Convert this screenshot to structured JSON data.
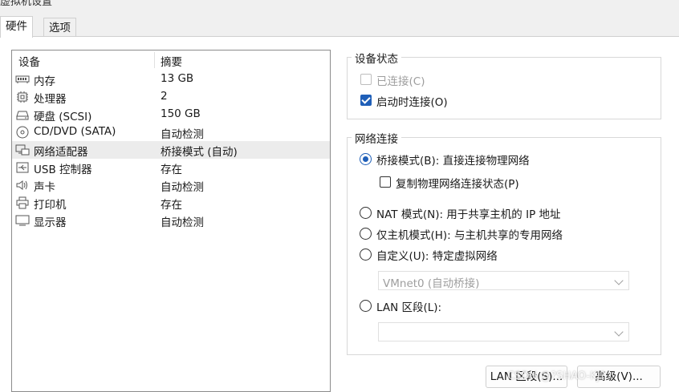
{
  "window": {
    "title_fragment": "虚拟机设置"
  },
  "tabs": [
    {
      "label": "硬件",
      "active": true
    },
    {
      "label": "选项",
      "active": false
    }
  ],
  "device_list": {
    "headers": {
      "device": "设备",
      "summary": "摘要"
    },
    "rows": [
      {
        "icon": "memory-icon",
        "name": "内存",
        "summary": "13 GB",
        "selected": false
      },
      {
        "icon": "processor-icon",
        "name": "处理器",
        "summary": "2",
        "selected": false
      },
      {
        "icon": "hard-disk-icon",
        "name": "硬盘 (SCSI)",
        "summary": "150 GB",
        "selected": false
      },
      {
        "icon": "cd-dvd-icon",
        "name": "CD/DVD (SATA)",
        "summary": "自动检测",
        "selected": false
      },
      {
        "icon": "network-adapter-icon",
        "name": "网络适配器",
        "summary": "桥接模式 (自动)",
        "selected": true
      },
      {
        "icon": "usb-icon",
        "name": "USB 控制器",
        "summary": "存在",
        "selected": false
      },
      {
        "icon": "sound-icon",
        "name": "声卡",
        "summary": "自动检测",
        "selected": false
      },
      {
        "icon": "printer-icon",
        "name": "打印机",
        "summary": "存在",
        "selected": false
      },
      {
        "icon": "display-icon",
        "name": "显示器",
        "summary": "自动检测",
        "selected": false
      }
    ]
  },
  "device_status": {
    "title": "设备状态",
    "connected": {
      "label": "已连接(C)",
      "checked": false,
      "disabled": true
    },
    "connect_at_power_on": {
      "label": "启动时连接(O)",
      "checked": true,
      "disabled": false
    }
  },
  "network_connection": {
    "title": "网络连接",
    "bridged": {
      "label": "桥接模式(B): 直接连接物理网络",
      "selected": true
    },
    "replicate_state": {
      "label": "复制物理网络连接状态(P)",
      "checked": false
    },
    "nat": {
      "label": "NAT 模式(N): 用于共享主机的 IP 地址",
      "selected": false
    },
    "host_only": {
      "label": "仅主机模式(H): 与主机共享的专用网络",
      "selected": false
    },
    "custom": {
      "label": "自定义(U): 特定虚拟网络",
      "selected": false
    },
    "custom_select_value": "VMnet0 (自动桥接)",
    "lan_segment": {
      "label": "LAN 区段(L):",
      "selected": false
    },
    "lan_select_value": ""
  },
  "buttons": {
    "lan_segments": "LAN 区段(S)...",
    "advanced": "高级(V)..."
  },
  "watermark": "CSDN @?SHAO-KJ?",
  "colors": {
    "accent": "#1f5fb8",
    "selected_row": "#ececec",
    "window_bg": "#f0f0f0"
  }
}
